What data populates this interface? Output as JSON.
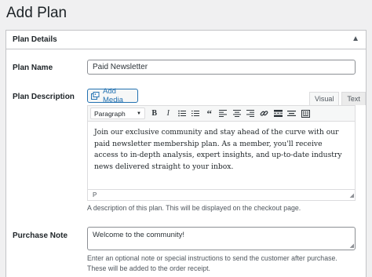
{
  "page": {
    "title": "Add Plan"
  },
  "panel": {
    "header": "Plan Details"
  },
  "plan_name": {
    "label": "Plan Name",
    "value": "Paid Newsletter"
  },
  "plan_description": {
    "label": "Plan Description",
    "add_media": "Add Media",
    "tab_visual": "Visual",
    "tab_text": "Text",
    "format": "Paragraph",
    "content": "Join our exclusive community and stay ahead of the curve with our paid newsletter membership plan. As a member, you'll receive access to in-depth analysis, expert insights, and up-to-date industry news delivered straight to your inbox.",
    "path": "P",
    "help": "A description of this plan. This will be displayed on the checkout page."
  },
  "purchase_note": {
    "label": "Purchase Note",
    "value": "Welcome to the community!",
    "help_line1": "Enter an optional note or special instructions to send the customer after purchase.",
    "help_line2": "These will be added to the order receipt."
  },
  "toolbar_icons": [
    "bold-icon",
    "italic-icon",
    "bullet-list-icon",
    "numbered-list-icon",
    "blockquote-icon",
    "align-left-icon",
    "align-center-icon",
    "align-right-icon",
    "link-icon",
    "read-more-icon",
    "fullscreen-icon",
    "kitchen-sink-icon"
  ],
  "colors": {
    "accent": "#2271b1",
    "border": "#c3c4c7",
    "background": "#f0f0f1"
  }
}
